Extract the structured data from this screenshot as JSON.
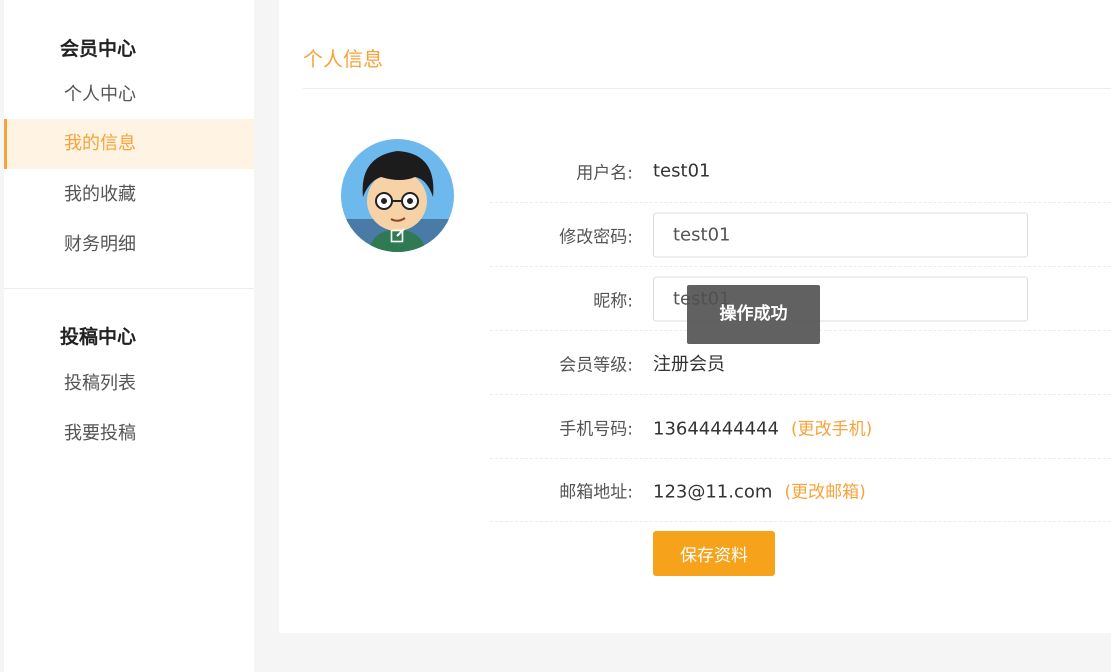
{
  "sidebar": {
    "member_center_title": "会员中心",
    "member_items": [
      {
        "label": "个人中心"
      },
      {
        "label": "我的信息",
        "active": true
      },
      {
        "label": "我的收藏"
      },
      {
        "label": "财务明细"
      }
    ],
    "submission_center_title": "投稿中心",
    "submission_items": [
      {
        "label": "投稿列表"
      },
      {
        "label": "我要投稿"
      }
    ]
  },
  "main": {
    "title": "个人信息",
    "avatar_edit_icon": "edit-icon",
    "fields": {
      "username": {
        "label": "用户名:",
        "value": "test01"
      },
      "password": {
        "label": "修改密码:",
        "value": "test01"
      },
      "nickname": {
        "label": "昵称:",
        "value": "test01"
      },
      "level": {
        "label": "会员等级:",
        "value": "注册会员"
      },
      "phone": {
        "label": "手机号码:",
        "value": "13644444444",
        "link": "(更改手机)"
      },
      "email": {
        "label": "邮箱地址:",
        "value": "123@11.com",
        "link": "(更改邮箱)"
      }
    },
    "save_label": "保存资料"
  },
  "toast": {
    "message": "操作成功"
  },
  "colors": {
    "accent": "#f7a33a",
    "button": "#f7a21b",
    "active_bg": "#fff3e3"
  }
}
